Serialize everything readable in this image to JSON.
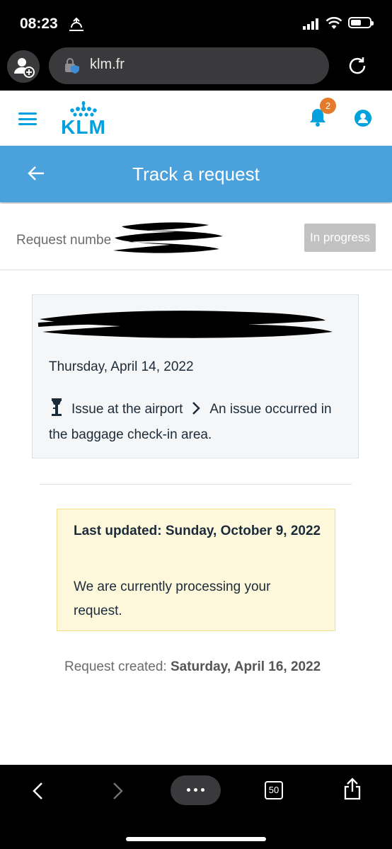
{
  "status_bar": {
    "time": "08:23"
  },
  "browser": {
    "url": "klm.fr",
    "tab_count": "50"
  },
  "app": {
    "brand": "KLM",
    "notification_count": "2"
  },
  "page": {
    "title": "Track a request",
    "request_label": "Request numbe",
    "status": "In progress",
    "issue": {
      "date": "Thursday, April 14, 2022",
      "category": "Issue at the airport",
      "detail": "An issue occurred in the baggage check-in area."
    },
    "notice": {
      "title": "Last updated: Sunday, October 9, 2022",
      "message": "We are currently processing your request."
    },
    "created": {
      "label": "Request created:",
      "date": "Saturday, April 16, 2022"
    }
  },
  "colors": {
    "accent": "#00a1de",
    "title_bar": "#4aa1dc",
    "badge": "#e47a2c",
    "status_pill": "#c2c2c2",
    "notice_bg": "#fdf8dc"
  },
  "icons": [
    "person-add-icon",
    "lock-shield-icon",
    "reload-icon",
    "menu-icon",
    "bell-icon",
    "account-icon",
    "back-arrow-icon",
    "control-tower-icon",
    "chevron-right-icon",
    "nav-back-icon",
    "nav-forward-icon",
    "more-icon",
    "tabs-icon",
    "share-icon"
  ]
}
